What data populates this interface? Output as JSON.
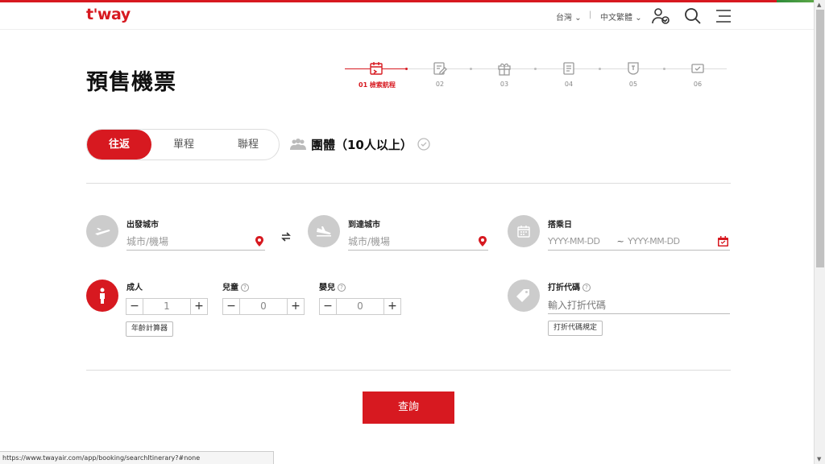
{
  "brand": {
    "logo": "t'way",
    "accent": "#d71920"
  },
  "header": {
    "region": "台灣",
    "language": "中文繁體",
    "icons": [
      "user-check-icon",
      "search-icon",
      "menu-icon"
    ]
  },
  "page": {
    "title": "預售機票"
  },
  "steps": [
    {
      "label": "01 檢索航程",
      "icon": "calendar-icon",
      "active": true
    },
    {
      "label": "02",
      "icon": "edit-icon",
      "active": false
    },
    {
      "label": "03",
      "icon": "gift-icon",
      "active": false
    },
    {
      "label": "04",
      "icon": "document-icon",
      "active": false
    },
    {
      "label": "05",
      "icon": "wallet-icon",
      "active": false
    },
    {
      "label": "06",
      "icon": "check-card-icon",
      "active": false
    }
  ],
  "trip_type": {
    "options": [
      "往返",
      "單程",
      "聯程"
    ],
    "selected": "往返"
  },
  "group": {
    "label": "團體（10人以上）",
    "icon": "group-icon"
  },
  "departure": {
    "label": "出發城市",
    "placeholder": "城市/機場"
  },
  "arrival": {
    "label": "到達城市",
    "placeholder": "城市/機場"
  },
  "date": {
    "label": "搭乘日",
    "start_placeholder": "YYYY-MM-DD",
    "separator": "~",
    "end_placeholder": "YYYY-MM-DD"
  },
  "passengers": {
    "adult": {
      "label": "成人",
      "value": "1"
    },
    "child": {
      "label": "兒童",
      "value": "0"
    },
    "infant": {
      "label": "嬰兒",
      "value": "0"
    },
    "age_calc": "年齡計算器"
  },
  "promo": {
    "label": "打折代碼",
    "placeholder": "輸入打折代碼",
    "rules": "打折代碼規定"
  },
  "search_button": "查詢",
  "status_url": "https://www.twayair.com/app/booking/searchItinerary?#none"
}
